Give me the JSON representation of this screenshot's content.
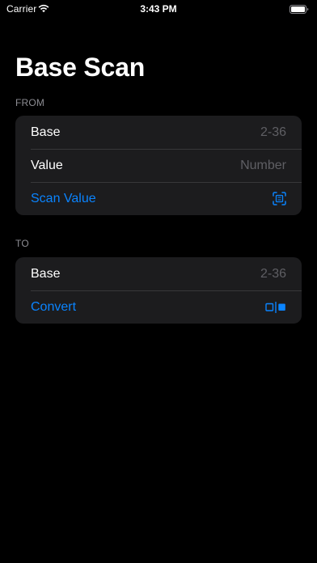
{
  "status_bar": {
    "carrier": "Carrier",
    "time": "3:43 PM",
    "icons": [
      "wifi-icon",
      "battery-icon"
    ]
  },
  "title": "Base Scan",
  "from_section": {
    "header": "FROM",
    "base_label": "Base",
    "base_placeholder": "2-36",
    "value_label": "Value",
    "value_placeholder": "Number",
    "scan_label": "Scan Value",
    "scan_icon": "text-viewfinder-icon"
  },
  "to_section": {
    "header": "TO",
    "base_label": "Base",
    "base_placeholder": "2-36",
    "convert_label": "Convert",
    "convert_icon": "square-split-icon"
  },
  "colors": {
    "background": "#000000",
    "group_background": "#1c1c1e",
    "accent": "#0a84ff",
    "secondary_text": "#8d8d93",
    "placeholder": "#5f5f64",
    "separator": "#38383a"
  }
}
